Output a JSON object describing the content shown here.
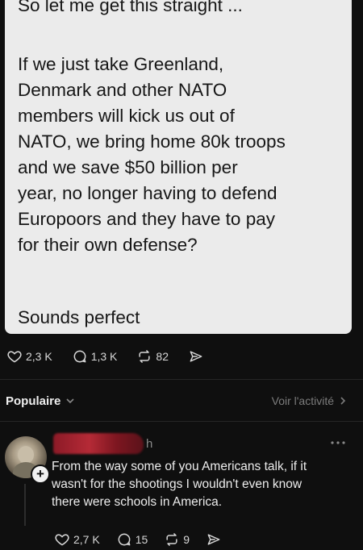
{
  "post": {
    "top_line": "So let me get this straight ...",
    "body_lines": [
      "If we just take Greenland,",
      "Denmark and other NATO",
      "members will kick us out of",
      "NATO, we bring home 80k troops",
      "and we save $50 billion per",
      "year, no longer having to defend",
      "Europoors and they have to pay",
      "for their own defense?"
    ],
    "closing_line": "Sounds perfect"
  },
  "post_actions": {
    "likes": "2,3 K",
    "replies": "1,3 K",
    "reposts": "82"
  },
  "sort_bar": {
    "sort_label": "Populaire",
    "activity_label": "Voir l'activité"
  },
  "reply": {
    "timestamp": "h",
    "lines": [
      "From the way some of you Americans talk, if it",
      "wasn't for the shootings I wouldn't even know",
      "there were schools in America."
    ],
    "actions": {
      "likes": "2,7 K",
      "replies": "15",
      "reposts": "9"
    }
  }
}
